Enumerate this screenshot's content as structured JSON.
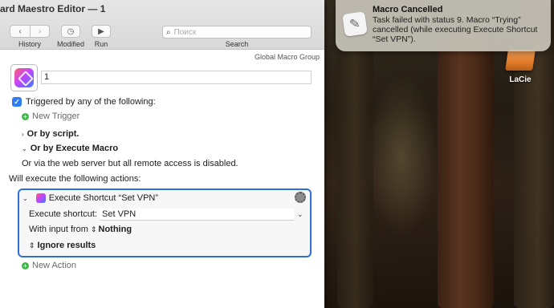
{
  "window": {
    "title": "ard Maestro Editor — 1"
  },
  "toolbar": {
    "history_label": "History",
    "modified_label": "Modified",
    "run_label": "Run",
    "search_label": "Search",
    "search_placeholder": "Поиск",
    "back_glyph": "‹",
    "forward_glyph": "›",
    "modified_icon": "clock-icon",
    "run_icon": "play-icon"
  },
  "macro": {
    "group": "Global Macro Group",
    "name": "1",
    "trigger_label": "Triggered by any of the following:",
    "new_trigger": "New Trigger",
    "or_by_script": "Or by script.",
    "or_by_execute_macro": "Or by Execute Macro",
    "web_server_note": "Or via the web server but all remote access is disabled.",
    "will_execute": "Will execute the following actions:",
    "new_action": "New Action"
  },
  "action": {
    "title": "Execute Shortcut “Set VPN”",
    "shortcut_label": "Execute shortcut:",
    "shortcut_value": "Set VPN",
    "input_label": "With input from",
    "input_value": "Nothing",
    "ignore_results": "Ignore results"
  },
  "notification": {
    "title": "Macro Cancelled",
    "body": "Task failed with status 9. Macro “Trying” cancelled (while executing Execute Shortcut “Set VPN”)."
  },
  "desktop": {
    "drive_label": "LaCie"
  },
  "colors": {
    "accent": "#2f7cf6",
    "action_border": "#2f6fd6",
    "add_green": "#43b44b"
  }
}
